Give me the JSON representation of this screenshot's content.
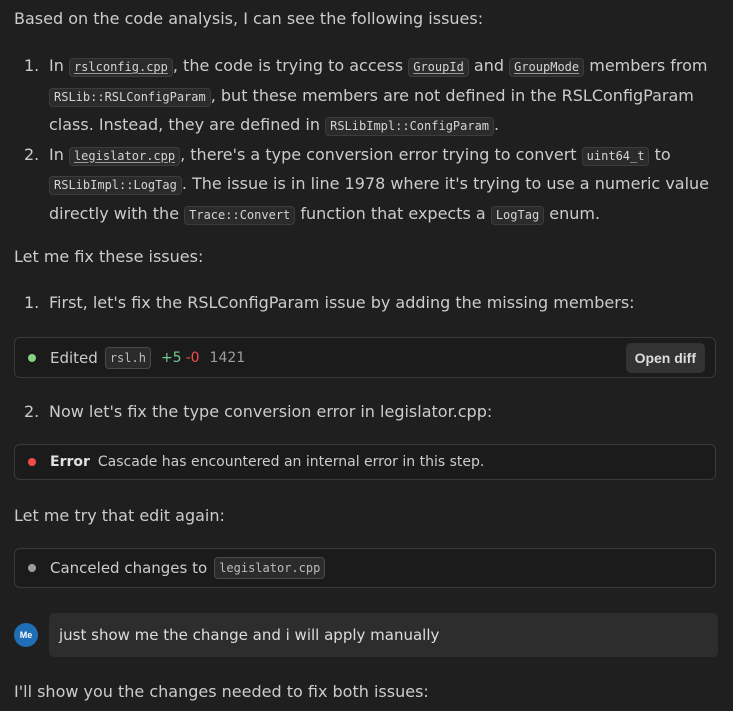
{
  "intro": "Based on the code analysis, I can see the following issues:",
  "issues": [
    {
      "num": "1.",
      "parts": {
        "in": "In",
        "file": "rslconfig.cpp",
        "t1": ", the code is trying to access",
        "code1": "GroupId",
        "and": "and",
        "code2": "GroupMode",
        "t2": "members from",
        "code3": "RSLib::RSLConfigParam",
        "t3": ", but these members are not defined in the RSLConfigParam class. Instead, they are defined in",
        "code4": "RSLibImpl::ConfigParam",
        "t4": "."
      }
    },
    {
      "num": "2.",
      "parts": {
        "in": "In",
        "file": "legislator.cpp",
        "t1": ", there's a type conversion error trying to convert",
        "code1": "uint64_t",
        "to": "to",
        "code2": "RSLibImpl::LogTag",
        "t2": ". The issue is in line 1978 where it's trying to use a numeric value directly with the",
        "code3": "Trace::Convert",
        "t3": "function that expects a",
        "code4": "LogTag",
        "t4": "enum."
      }
    }
  ],
  "fix_intro": "Let me fix these issues:",
  "steps": [
    {
      "num": "1.",
      "text": "First, let's fix the RSLConfigParam issue by adding the missing members:"
    },
    {
      "num": "2.",
      "text": "Now let's fix the type conversion error in legislator.cpp:"
    }
  ],
  "edit_card": {
    "label": "Edited",
    "file": "rsl.h",
    "added": "+5",
    "removed": "-0",
    "line": "1421",
    "button": "Open diff",
    "dot_color": "#89d185"
  },
  "error_card": {
    "label": "Error",
    "message": "Cascade has encountered an internal error in this step.",
    "dot_color": "#f14c4c"
  },
  "retry_text": "Let me try that edit again:",
  "cancel_card": {
    "label": "Canceled changes to",
    "file": "legislator.cpp",
    "dot_color": "#9d9d9d"
  },
  "user_message": {
    "avatar": "Me",
    "text": "just show me the change and i will apply manually"
  },
  "final_text": "I'll show you the changes needed to fix both issues:",
  "colors": {
    "added": "#73c991",
    "removed": "#f14c4c",
    "line": "#9d9d9d",
    "avatar": "#1e6fb5"
  }
}
